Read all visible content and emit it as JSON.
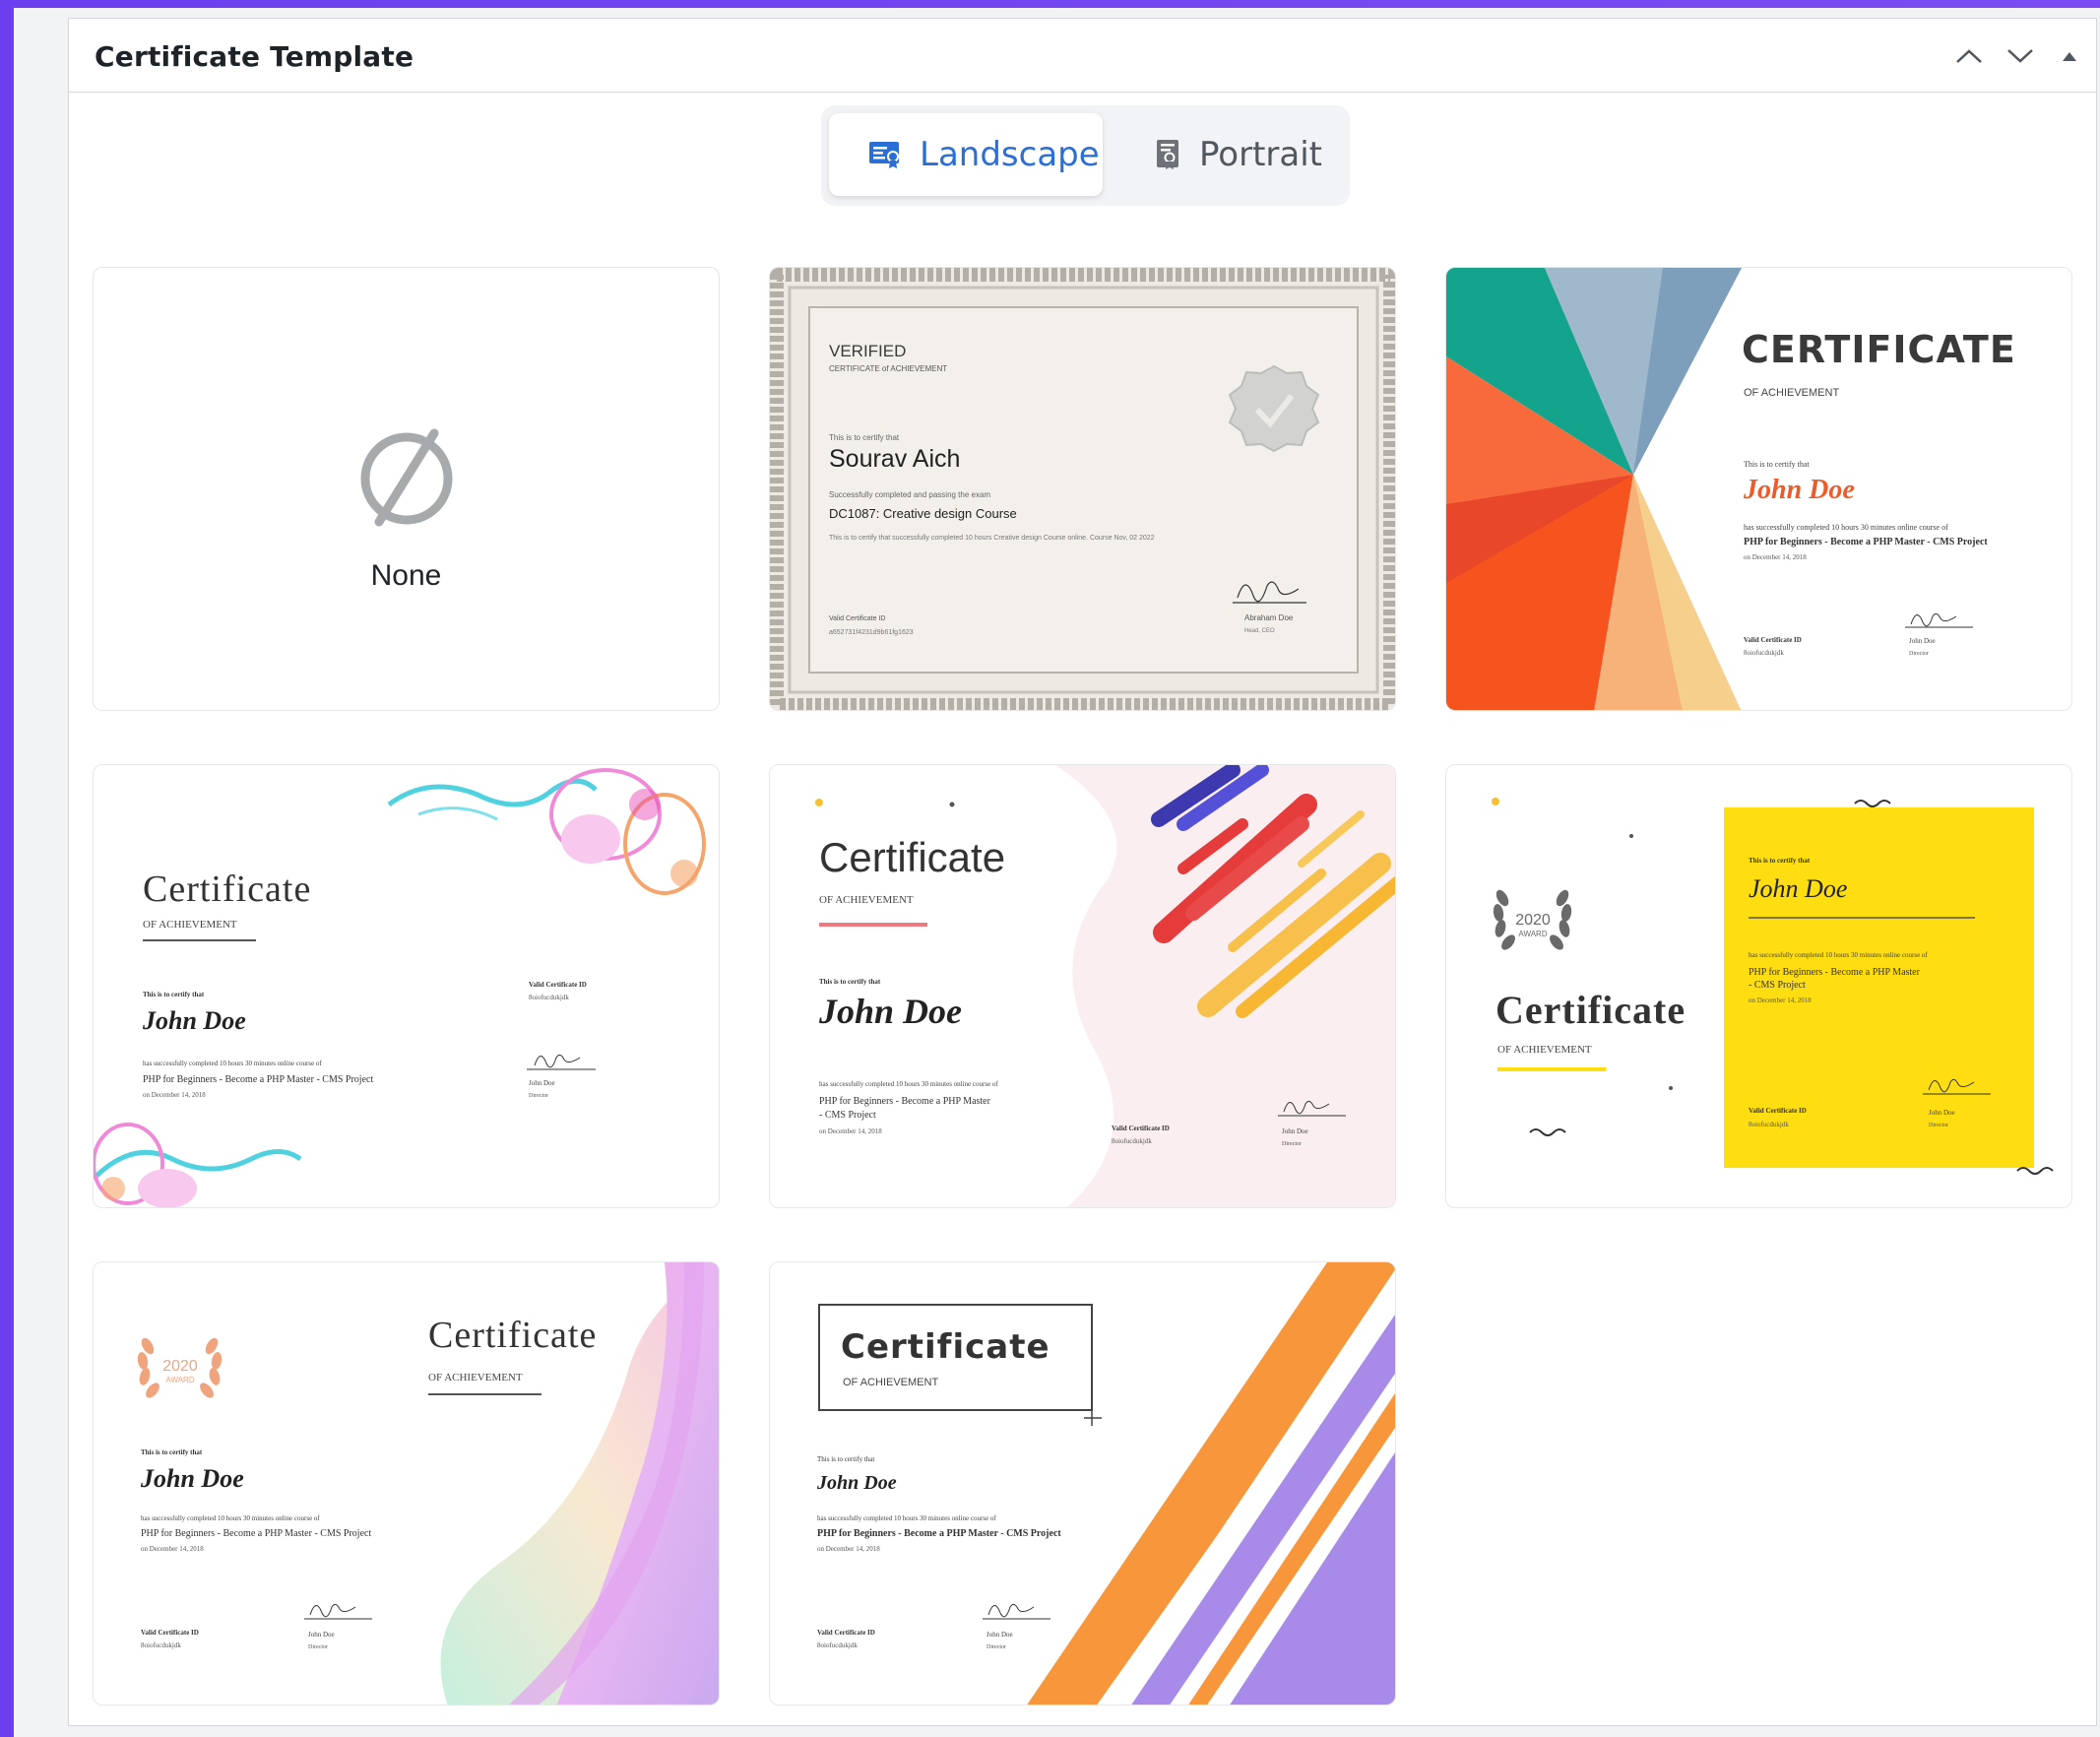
{
  "panel": {
    "title": "Certificate Template",
    "controls": [
      "chevron-up-icon",
      "chevron-down-icon",
      "triangle-up-icon"
    ]
  },
  "tabs": [
    {
      "label": "Landscape",
      "icon": "landscape-certificate-icon",
      "active": true
    },
    {
      "label": "Portrait",
      "icon": "portrait-certificate-icon",
      "active": false
    }
  ],
  "colors": {
    "accent": "#2a6fd6",
    "background": "#7245f1"
  },
  "templates": [
    {
      "label": "None",
      "icon": "none-symbol-icon"
    },
    {
      "heading": "VERIFIED",
      "subheading": "CERTIFICATE of ACHIEVEMENT",
      "intro": "This is to certify that",
      "name": "Sourav Aich",
      "course_intro": "Successfully completed and passing the exam",
      "course": "DC1087: Creative design Course",
      "note": "This is to certify that successfully completed 10 hours Creative design Course online. Course Nov, 02 2022",
      "cert_id_label": "Valid Certificate ID",
      "cert_id": "a652731f4231d9b61fg1623",
      "signer": "Abraham Doe",
      "signer_role": "Head, CEO"
    },
    {
      "title": "CERTIFICATE",
      "subtitle": "OF ACHIEVEMENT",
      "intro": "This is to certify that",
      "name": "John Doe",
      "desc": "has successfully completed 10 hours 30 minutes online course of",
      "course": "PHP for Beginners - Become a PHP Master - CMS Project",
      "date": "on December 14, 2018",
      "id_label": "Valid Certificate ID",
      "id": "8oiofucdukjdk",
      "signer": "John Doe",
      "signer_role": "Director"
    },
    {
      "title": "Certificate",
      "subtitle": "OF ACHIEVEMENT",
      "intro": "This is to certify that",
      "name": "John Doe",
      "desc": "has successfully completed 10 hours 30 minutes online course of",
      "course": "PHP for Beginners - Become a PHP Master - CMS Project",
      "date": "on December 14, 2018",
      "id_label": "Valid Certificate ID",
      "id": "8oiofucdukjdk",
      "signer": "John Doe",
      "signer_role": "Director"
    },
    {
      "title": "Certificate",
      "subtitle": "OF ACHIEVEMENT",
      "intro": "This is to certify that",
      "name": "John Doe",
      "desc": "has successfully completed 10 hours 30 minutes online course of",
      "course1": "PHP for Beginners - Become a PHP Master",
      "course2": "- CMS Project",
      "date": "on December 14, 2018",
      "id_label": "Valid Certificate ID",
      "id": "8oiofucdukjdk",
      "signer": "John Doe",
      "signer_role": "Director"
    },
    {
      "award_year": "2020",
      "award_word": "AWARD",
      "title": "Certificate",
      "subtitle": "OF ACHIEVEMENT",
      "intro": "This is to certify that",
      "name": "John Doe",
      "desc": "has successfully completed 10 hours 30 minutes online course of",
      "course1": "PHP for Beginners - Become a PHP Master",
      "course2": "- CMS Project",
      "date": "on December 14, 2018",
      "id_label": "Valid Certificate ID",
      "id": "8oiofucdukjdk",
      "signer": "John Doe",
      "signer_role": "Director"
    },
    {
      "award_year": "2020",
      "award_word": "AWARD",
      "title": "Certificate",
      "subtitle": "OF ACHIEVEMENT",
      "intro": "This is to certify that",
      "name": "John Doe",
      "desc": "has successfully completed 10 hours 30 minutes online course of",
      "course": "PHP for Beginners - Become a PHP Master - CMS Project",
      "date": "on December 14, 2018",
      "id_label": "Valid Certificate ID",
      "id": "8oiofucdukjdk",
      "signer": "John Doe",
      "signer_role": "Director"
    },
    {
      "title": "Certificate",
      "subtitle": "OF ACHIEVEMENT",
      "intro": "This is to certify that",
      "name": "John Doe",
      "desc": "has successfully completed 10 hours 30 minutes online course of",
      "course": "PHP for Beginners - Become a PHP Master - CMS Project",
      "date": "on December 14, 2018",
      "id_label": "Valid Certificate ID",
      "id": "8oiofucdukjdk",
      "signer": "John Doe",
      "signer_role": "Director"
    }
  ]
}
